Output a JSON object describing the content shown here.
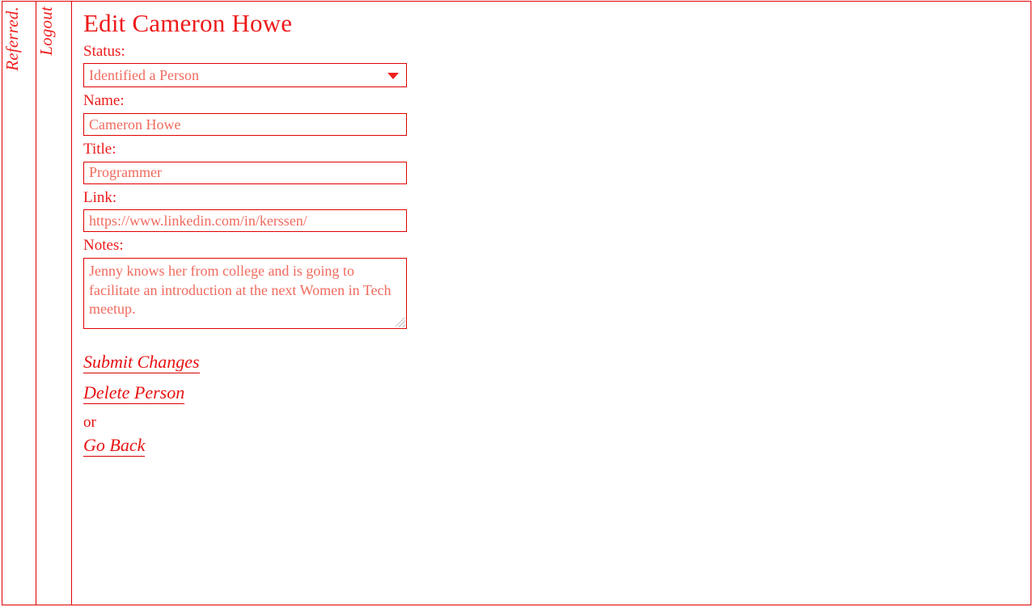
{
  "sidebar": {
    "rails": [
      {
        "name": "referred",
        "label": "Referred."
      },
      {
        "name": "logout",
        "label": "Logout"
      }
    ]
  },
  "main": {
    "title": "Edit Cameron Howe",
    "fields": {
      "status": {
        "label": "Status:",
        "value": "Identified a Person",
        "caret_icon": "chevron-down-icon"
      },
      "name": {
        "label": "Name:",
        "value": "Cameron Howe"
      },
      "title": {
        "label": "Title:",
        "value": "Programmer"
      },
      "link": {
        "label": "Link:",
        "value": "https://www.linkedin.com/in/kerssen/"
      },
      "notes": {
        "label": "Notes:",
        "value": "Jenny knows her from college and is going to facilitate an introduction at the next Women in Tech meetup.",
        "resize_icon": "resize-grip-icon"
      }
    },
    "actions": {
      "submit": "Submit Changes",
      "delete": "Delete Person",
      "separator": "or",
      "back": "Go Back"
    }
  },
  "colors": {
    "accent": "#e00000",
    "text": "#e81212",
    "input_text": "#f06a5e",
    "background": "#ffffff"
  }
}
